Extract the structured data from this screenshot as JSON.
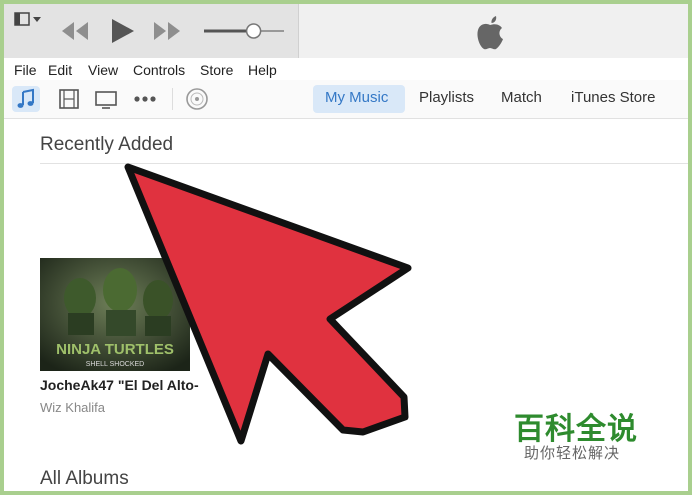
{
  "menu": [
    "File",
    "Edit",
    "View",
    "Controls",
    "Store",
    "Help"
  ],
  "media_icons": [
    "music-note-icon",
    "film-icon",
    "tv-icon",
    "more-icon",
    "cd-icon"
  ],
  "tabs": {
    "my_music": "My Music",
    "playlists": "Playlists",
    "match": "Match",
    "itunes_store": "iTunes Store"
  },
  "main": {
    "recently_added_title": "Recently Added",
    "album": {
      "title": "JocheAk47 \"El Del Alto-",
      "artist": "Wiz Khalifa",
      "cover_text": "NINJA TURTLES",
      "cover_subtext": "SHELL SHOCKED"
    },
    "all_albums_title": "All Albums"
  },
  "volume_level": 0.62,
  "watermark": {
    "main": "百科全说",
    "sub": "助你轻松解决"
  },
  "colors": {
    "arrow": "#e0323f",
    "accent": "#3478c6",
    "watermark": "#2e8b2e",
    "frame": "#a9cf8e"
  }
}
